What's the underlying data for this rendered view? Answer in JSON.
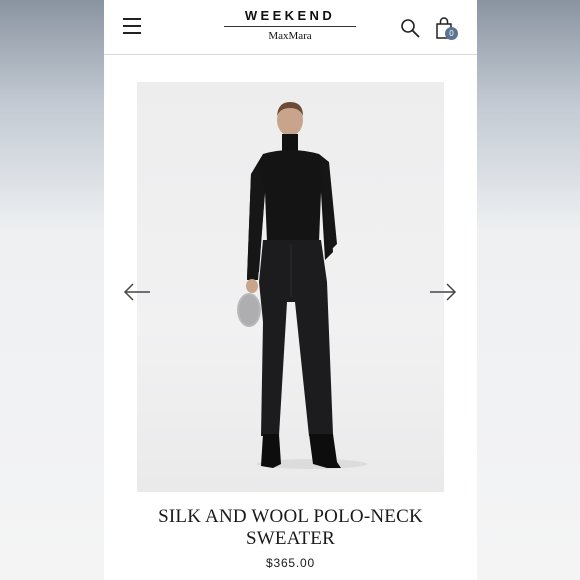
{
  "header": {
    "brand_top": "WEEKEND",
    "brand_bottom": "MaxMara",
    "cart_count": "0",
    "icons": [
      "menu-icon",
      "search-icon",
      "shopping-bag-icon"
    ]
  },
  "product": {
    "image_icon": "model-photo",
    "title_line1": "SILK AND WOOL POLO-NECK",
    "title_line2": "SWEATER",
    "price": "$365.00"
  },
  "carousel": {
    "prev_icon": "arrow-left-icon",
    "next_icon": "arrow-right-icon"
  }
}
